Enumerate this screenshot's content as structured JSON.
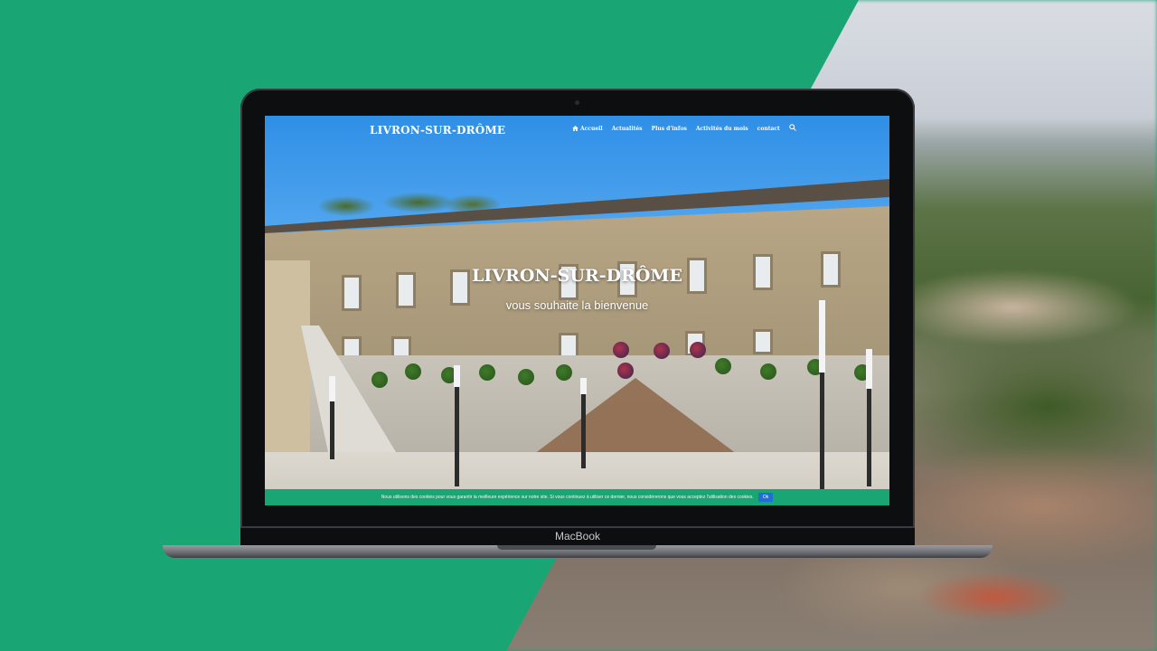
{
  "device": {
    "brand": "MacBook"
  },
  "site": {
    "logo": "LIVRON-SUR-DRÔME",
    "nav": [
      {
        "label": "Accueil",
        "icon": "home-icon",
        "active": true
      },
      {
        "label": "Actualités"
      },
      {
        "label": "Plus d'infos"
      },
      {
        "label": "Activités du mois"
      },
      {
        "label": "contact"
      }
    ],
    "search_icon": "search-icon",
    "hero": {
      "title": "LIVRON-SUR-DRÔME",
      "subtitle": "vous souhaite la bienvenue"
    },
    "cookie": {
      "text": "Nous utilisons des cookies pour vous garantir la meilleure expérience sur notre site. Si vous continuez à utiliser ce dernier, nous considérerons que vous acceptez l'utilisation des cookies.",
      "button": "Ok"
    }
  },
  "colors": {
    "brand_green": "#1aa574",
    "cookie_button": "#1d6fd6"
  }
}
